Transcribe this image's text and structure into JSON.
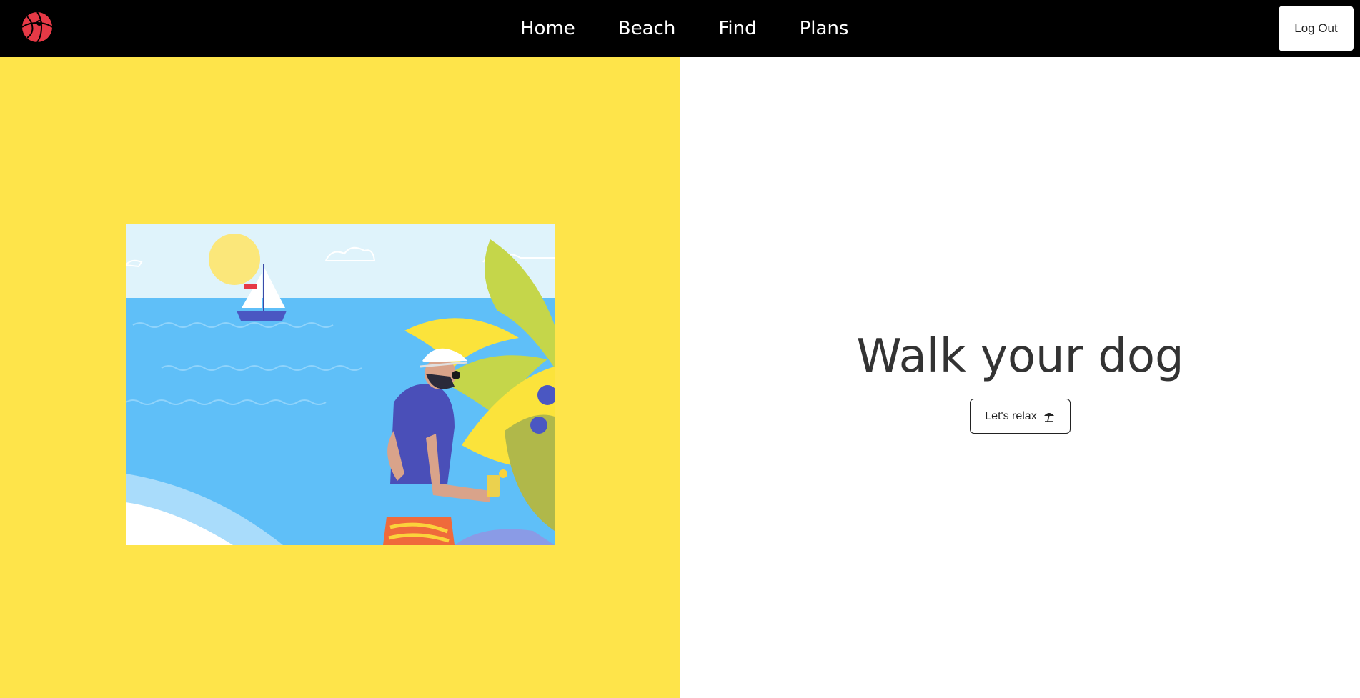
{
  "navbar": {
    "logo_icon": "beach-ball-icon",
    "links": [
      {
        "label": "Home"
      },
      {
        "label": "Beach"
      },
      {
        "label": "Find"
      },
      {
        "label": "Plans"
      }
    ],
    "logout_label": "Log Out"
  },
  "hero": {
    "illustration": "man-at-beach-illustration",
    "title": "Walk your dog",
    "cta_label": "Let's relax",
    "cta_icon": "beach-umbrella-icon"
  },
  "colors": {
    "navbar_bg": "#000000",
    "left_panel_bg": "#fee44a",
    "logo_red": "#e63946",
    "text_dark": "#333333"
  }
}
